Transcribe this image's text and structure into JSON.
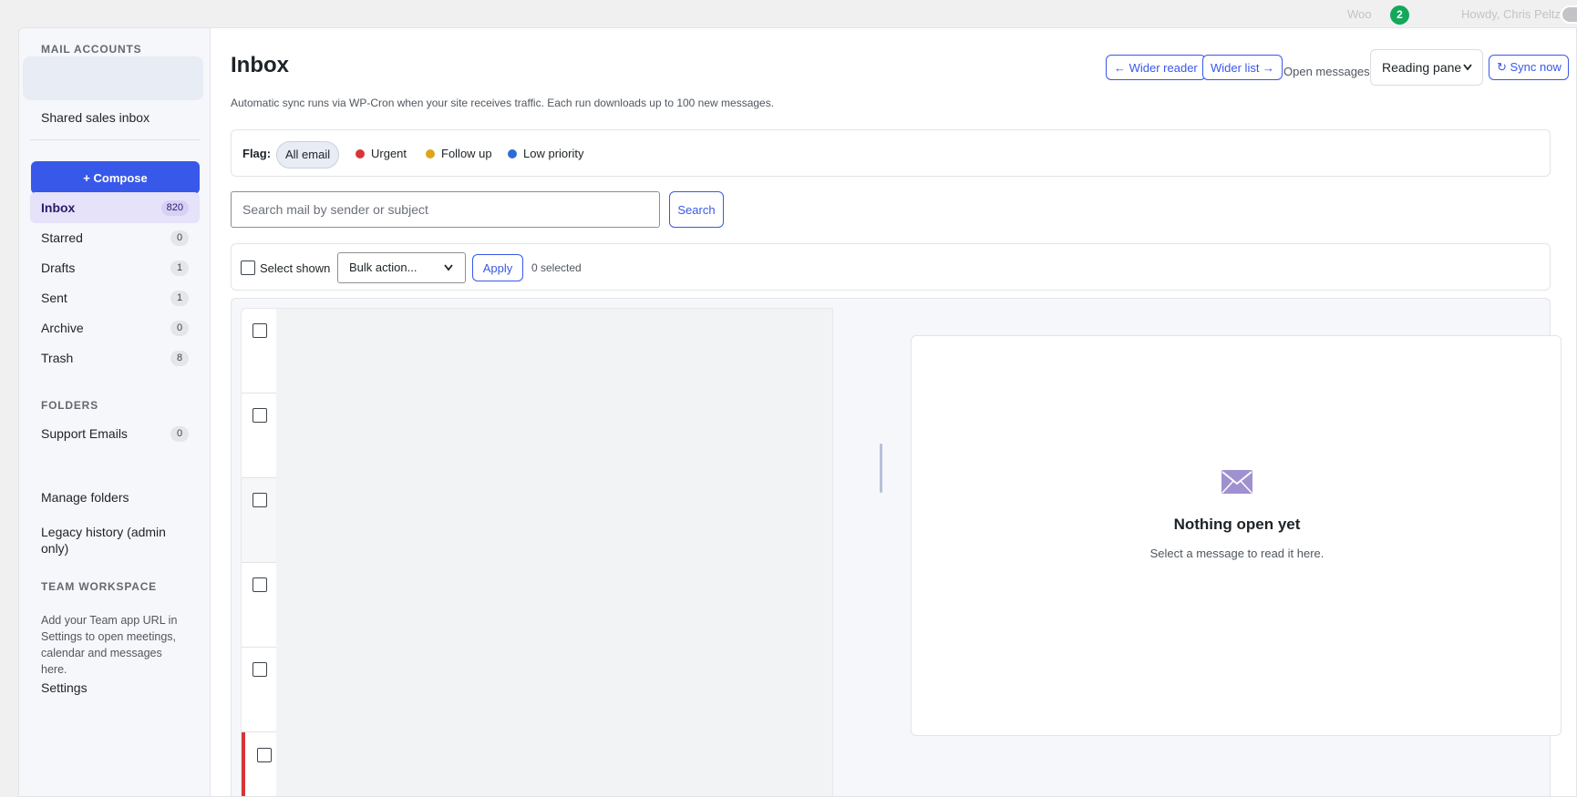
{
  "adminbar": {
    "woo_label": "Woo",
    "notification_count": "2",
    "howdy_text": "Howdy, Chris Peltz"
  },
  "sidebar": {
    "mail_accounts_label": "MAIL ACCOUNTS",
    "shared_inbox_label": "Shared sales inbox",
    "compose_label": "+ Compose",
    "items": [
      {
        "label": "Inbox",
        "count": "820"
      },
      {
        "label": "Starred",
        "count": "0"
      },
      {
        "label": "Drafts",
        "count": "1"
      },
      {
        "label": "Sent",
        "count": "1"
      },
      {
        "label": "Archive",
        "count": "0"
      },
      {
        "label": "Trash",
        "count": "8"
      }
    ],
    "folders_label": "FOLDERS",
    "folders": [
      {
        "label": "Support Emails",
        "count": "0"
      }
    ],
    "manage_folders_label": "Manage folders",
    "legacy_history_label": "Legacy history (admin only)",
    "team_workspace_label": "TEAM WORKSPACE",
    "team_note": "Add your Team app URL in Settings to open meetings, calendar and messages here.",
    "settings_label": "Settings"
  },
  "main": {
    "title": "Inbox",
    "subtitle": "Automatic sync runs via WP-Cron when your site receives traffic. Each run downloads up to 100 new messages.",
    "toolbar": {
      "wider_reader_label": "← Wider reader",
      "wider_list_label": "Wider list →",
      "open_messages_label": "Open messages",
      "open_messages_value": "Reading pane",
      "sync_label": "↻ Sync now"
    },
    "flags": {
      "label": "Flag:",
      "options": [
        {
          "label": "All email",
          "color": ""
        },
        {
          "label": "Urgent",
          "color": "#d63638"
        },
        {
          "label": "Follow up",
          "color": "#dba617"
        },
        {
          "label": "Low priority",
          "color": "#2c6cd9"
        }
      ]
    },
    "search": {
      "placeholder": "Search mail by sender or subject",
      "value": "",
      "button_label": "Search"
    },
    "bulk": {
      "select_shown_label": "Select shown",
      "action_value": "Bulk action...",
      "apply_label": "Apply",
      "selected_text": "0 selected"
    },
    "reader": {
      "empty_title": "Nothing open yet",
      "empty_subtitle": "Select a message to read it here."
    }
  },
  "colors": {
    "accent": "#3858e9",
    "urgent": "#d63638",
    "follow_up": "#dba617",
    "low_priority": "#2c6cd9",
    "mail_icon": "#9f90d0"
  }
}
